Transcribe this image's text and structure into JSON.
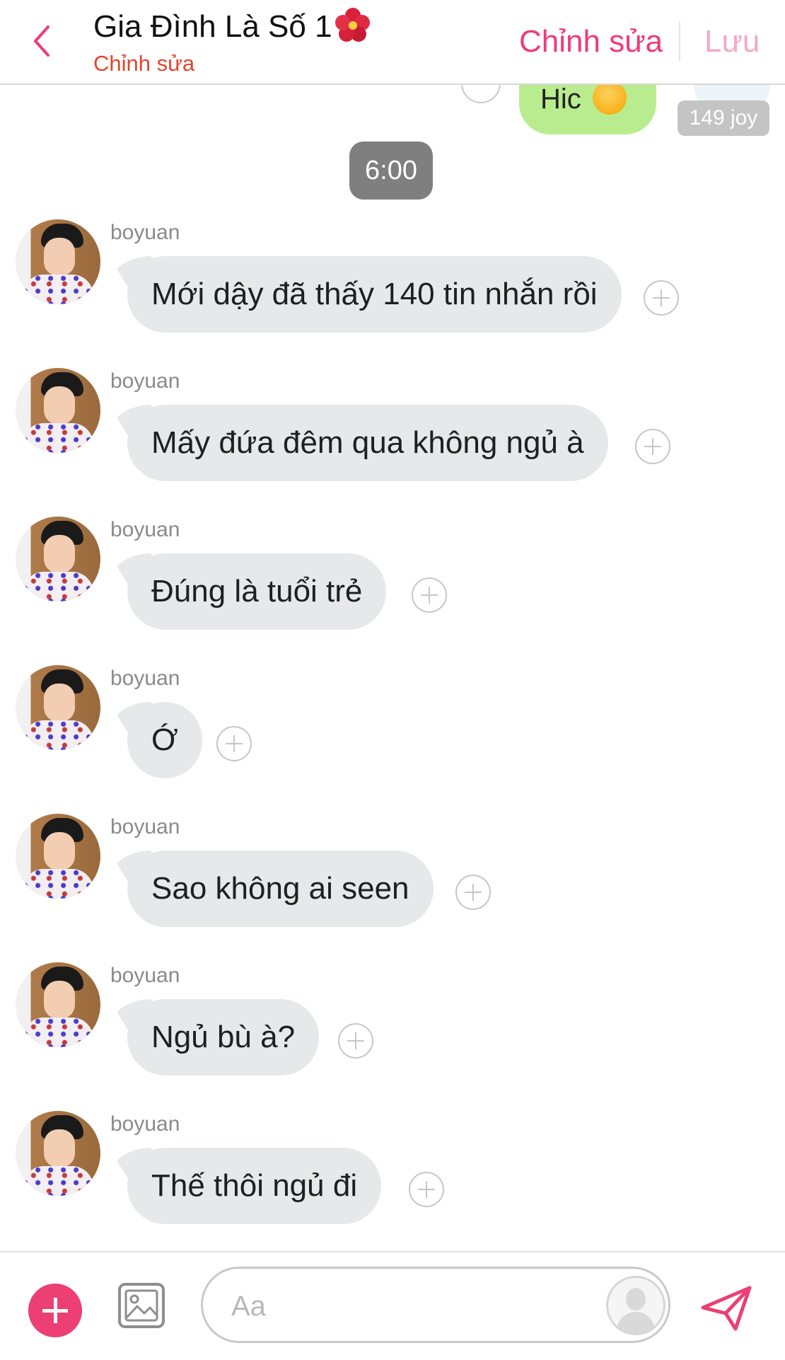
{
  "header": {
    "title": "Gia Đình Là Số 1",
    "subtitle": "Chỉnh sửa",
    "edit_label": "Chỉnh sửa",
    "save_label": "Lưu",
    "title_emoji": "hibiscus-icon"
  },
  "partial_message": {
    "text": "Hic",
    "emoji": "anxious-sweat-face-icon",
    "reaction_badge": "149 joy"
  },
  "timestamp": "6:00",
  "messages": [
    {
      "sender": "boyuan",
      "text": "Mới dậy đã thấy 140 tin nhắn rồi"
    },
    {
      "sender": "boyuan",
      "text": "Mấy đứa đêm qua không ngủ à"
    },
    {
      "sender": "boyuan",
      "text": "Đúng là tuổi trẻ"
    },
    {
      "sender": "boyuan",
      "text": "Ớ"
    },
    {
      "sender": "boyuan",
      "text": "Sao không ai seen"
    },
    {
      "sender": "boyuan",
      "text": "Ngủ bù à?"
    },
    {
      "sender": "boyuan",
      "text": "Thế thôi ngủ đi"
    }
  ],
  "composer": {
    "placeholder": "Aa",
    "value": ""
  },
  "colors": {
    "accent": "#ec3f74",
    "subtitle": "#e2452b",
    "bubble_in": "#e7e8ea",
    "bubble_out": "#b9ec8f",
    "time_pill": "#7f7f7f"
  }
}
